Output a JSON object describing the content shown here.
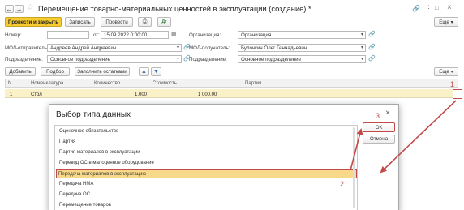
{
  "title": "Перемещение товарно-материальных ценностей в эксплуатации (создание) *",
  "toolbar": {
    "post_close": "Провести и закрыть",
    "write": "Записать",
    "post": "Провести",
    "more": "Еще"
  },
  "header_fields": {
    "number_label": "Номер:",
    "number_value": "",
    "from_label": "от:",
    "date_value": "15.09.2022  0:00:00",
    "org_label": "Организация:",
    "org_value": "Организация",
    "sender_label": "МОЛ-отправитель:",
    "sender_value": "Андреев Андрей Андреевич",
    "receiver_label": "МОЛ-получатель:",
    "receiver_value": "Булочкин Олег Геннадьевич",
    "dept_label": "Подразделение:",
    "dept_value": "Основное подразделение",
    "dept2_label": "Подразделение:",
    "dept2_value": "Основное подразделение"
  },
  "table_toolbar": {
    "add": "Добавить",
    "select": "Подбор",
    "fill": "Заполнить остатками",
    "more": "Еще"
  },
  "table": {
    "columns": [
      "N",
      "Номенклатура",
      "Количество",
      "Стоимость",
      "Партия"
    ],
    "rows": [
      {
        "n": "1",
        "item": "Стол",
        "qty": "1,000",
        "cost": "1 000,00",
        "batch": ""
      }
    ]
  },
  "dialog": {
    "title": "Выбор типа данных",
    "ok": "ОК",
    "cancel": "Отмена",
    "items": [
      "Оценочное обязательство",
      "Партия",
      "Партия материалов в эксплуатации",
      "Перевод ОС в малоценное оборудование",
      "Передача материалов в эксплуатацию",
      "Передача НМА",
      "Передача ОС",
      "Перемещение товаров"
    ],
    "selected_index": 4
  },
  "annotations": {
    "step1": "1",
    "step2": "2",
    "step3": "3",
    "color": "#c24a4a"
  },
  "colors": {
    "primary_button": "#f6cc30",
    "row_highlight": "#fbf1c8",
    "selection": "#f8d98a"
  }
}
